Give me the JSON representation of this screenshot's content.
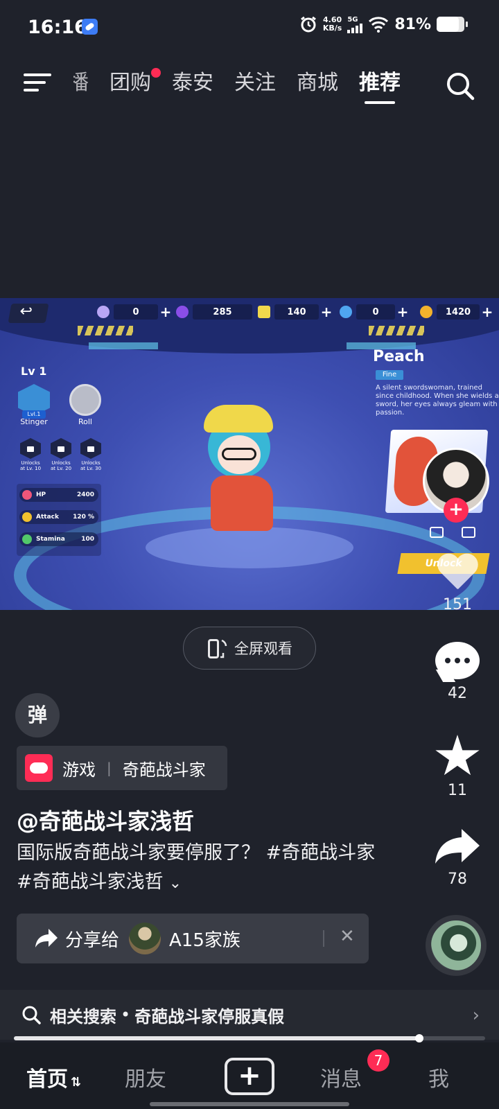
{
  "status_bar": {
    "time": "16:16",
    "net_speed_value": "4.60",
    "net_speed_unit": "KB/s",
    "network": "5G",
    "battery_text": "81%",
    "battery_level": 0.81
  },
  "top_nav": {
    "tabs": [
      {
        "label": "播",
        "active": false,
        "partial": true
      },
      {
        "label": "团购",
        "active": false,
        "dot": true
      },
      {
        "label": "泰安",
        "active": false
      },
      {
        "label": "关注",
        "active": false
      },
      {
        "label": "商城",
        "active": false
      },
      {
        "label": "推荐",
        "active": true
      }
    ],
    "icons": [
      "menu-icon",
      "search-icon"
    ]
  },
  "game_video": {
    "resources": [
      {
        "value": "0",
        "color": "#b9a6f5"
      },
      {
        "value": "285",
        "color": "#8b4ee8"
      },
      {
        "value": "140",
        "color": "#f1d84c"
      },
      {
        "value": "0",
        "color": "#4fa6f0"
      },
      {
        "value": "1420",
        "color": "#f2b22c"
      }
    ],
    "level": "Lv 1",
    "skills": [
      {
        "name": "Stinger",
        "badge": "Lvl.1"
      },
      {
        "name": "Roll"
      }
    ],
    "locks": [
      {
        "line1": "Unlocks",
        "line2": "at Lv. 10"
      },
      {
        "line1": "Unlocks",
        "line2": "at Lv. 20"
      },
      {
        "line1": "Unlocks",
        "line2": "at Lv. 30"
      }
    ],
    "stats": [
      {
        "name": "HP",
        "value": "2400",
        "color": "#f0567a"
      },
      {
        "name": "Attack",
        "value": "120 %",
        "color": "#f1c12e"
      },
      {
        "name": "Stamina",
        "value": "100",
        "color": "#52c86a"
      }
    ],
    "hero_name": "Peach",
    "hero_tag": "Fine",
    "hero_desc": "A silent swordswoman, trained since childhood. When she wields a sword, her eyes always gleam with passion.",
    "unlock_label": "Unlock"
  },
  "actions": {
    "like_count": "151",
    "comment_count": "42",
    "favorite_count": "11",
    "share_count": "78"
  },
  "fullscreen_label": "全屏观看",
  "danmu_label": "弹",
  "game_tag": {
    "category": "游戏",
    "name": "奇葩战斗家"
  },
  "author": "@奇葩战斗家浅哲",
  "caption": "国际版奇葩战斗家要停服了？ #奇葩战斗家 #奇葩战斗家浅哲",
  "share_bar": {
    "label": "分享给",
    "target": "A15家族"
  },
  "related_search": {
    "prefix": "相关搜索",
    "dot": "•",
    "query": "奇葩战斗家停服真假"
  },
  "progress": 0.86,
  "bottom_nav": {
    "home": "首页",
    "friends": "朋友",
    "messages": "消息",
    "messages_badge": "7",
    "me": "我"
  }
}
